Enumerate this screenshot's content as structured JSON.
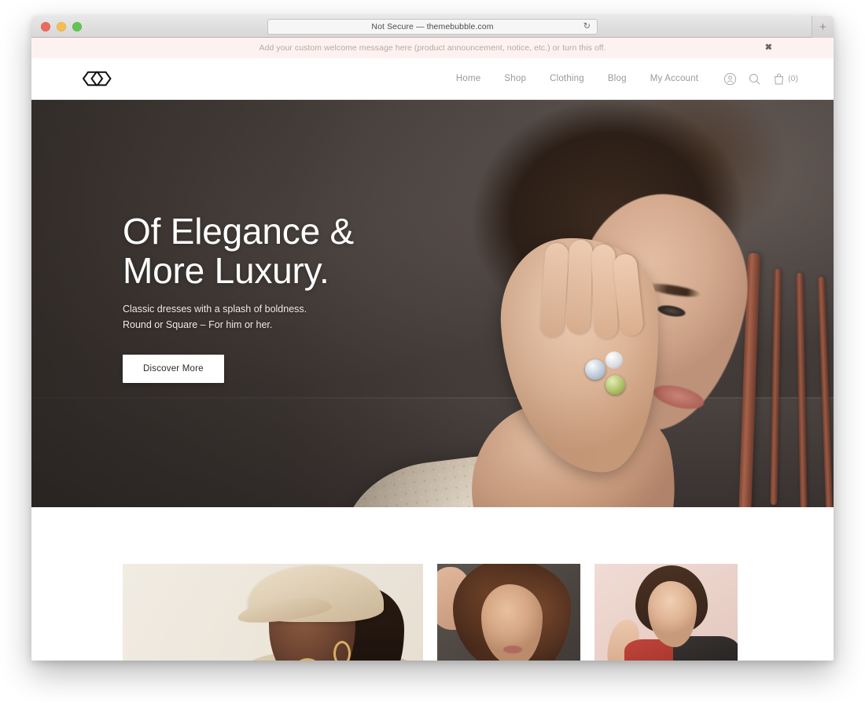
{
  "browser": {
    "url_text": "Not Secure — themebubble.com",
    "reload_icon": "reload-icon",
    "newtab_label": "+",
    "traffic_lights": [
      "close",
      "minimize",
      "zoom"
    ]
  },
  "notice": {
    "message": "Add your custom welcome message here (product announcement, notice, etc.) or turn this off.",
    "close_label": "✖",
    "background": "#fdf2ef"
  },
  "header": {
    "logo_name": "site-logo",
    "nav": [
      {
        "label": "Home"
      },
      {
        "label": "Shop"
      },
      {
        "label": "Clothing"
      },
      {
        "label": "Blog"
      },
      {
        "label": "My Account"
      }
    ],
    "icons": {
      "account": "account-icon",
      "search": "search-icon",
      "cart": "cart-icon",
      "cart_count": "(0)"
    }
  },
  "hero": {
    "title_line1": "Of Elegance &",
    "title_line2": "More Luxury.",
    "subtitle_line1": "Classic dresses with a splash of boldness.",
    "subtitle_line2": "Round or Square – For him or her.",
    "cta_label": "Discover More",
    "background_color": "#4c4542"
  },
  "products": {
    "cards": [
      {
        "name": "product-card-1",
        "alt": "Model wearing beige cap and coat"
      },
      {
        "name": "product-card-2",
        "alt": "Model with curly hair"
      },
      {
        "name": "product-card-3",
        "alt": "Model in red and black dress"
      }
    ]
  }
}
